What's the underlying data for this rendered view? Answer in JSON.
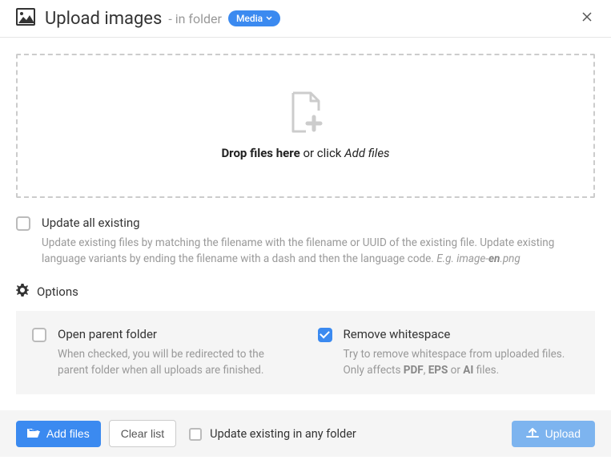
{
  "header": {
    "title": "Upload images",
    "subtitle": "- in folder",
    "folder_badge": "Media"
  },
  "dropzone": {
    "bold": "Drop files here",
    "plain": "or click",
    "italic": "Add files"
  },
  "update_all": {
    "label": "Update all existing",
    "desc_plain1": "Update existing files by matching the filename with the filename or UUID of the existing file. Update existing language variants by ending the filename with a dash and then the language code. ",
    "desc_italic_pre": "E.g. image-",
    "desc_bold": "en",
    "desc_italic_post": ".png"
  },
  "options_label": "Options",
  "option_open": {
    "label": "Open parent folder",
    "desc": "When checked, you will be redirected to the parent folder when all uploads are finished."
  },
  "option_ws": {
    "label": "Remove whitespace",
    "desc_pre": "Try to remove whitespace from uploaded files. Only affects ",
    "b1": "PDF",
    "sep1": ", ",
    "b2": "EPS",
    "sep2": " or ",
    "b3": "AI",
    "post": " files."
  },
  "footer": {
    "add_files": "Add files",
    "clear_list": "Clear list",
    "update_any": "Update existing in any folder",
    "upload": "Upload"
  }
}
